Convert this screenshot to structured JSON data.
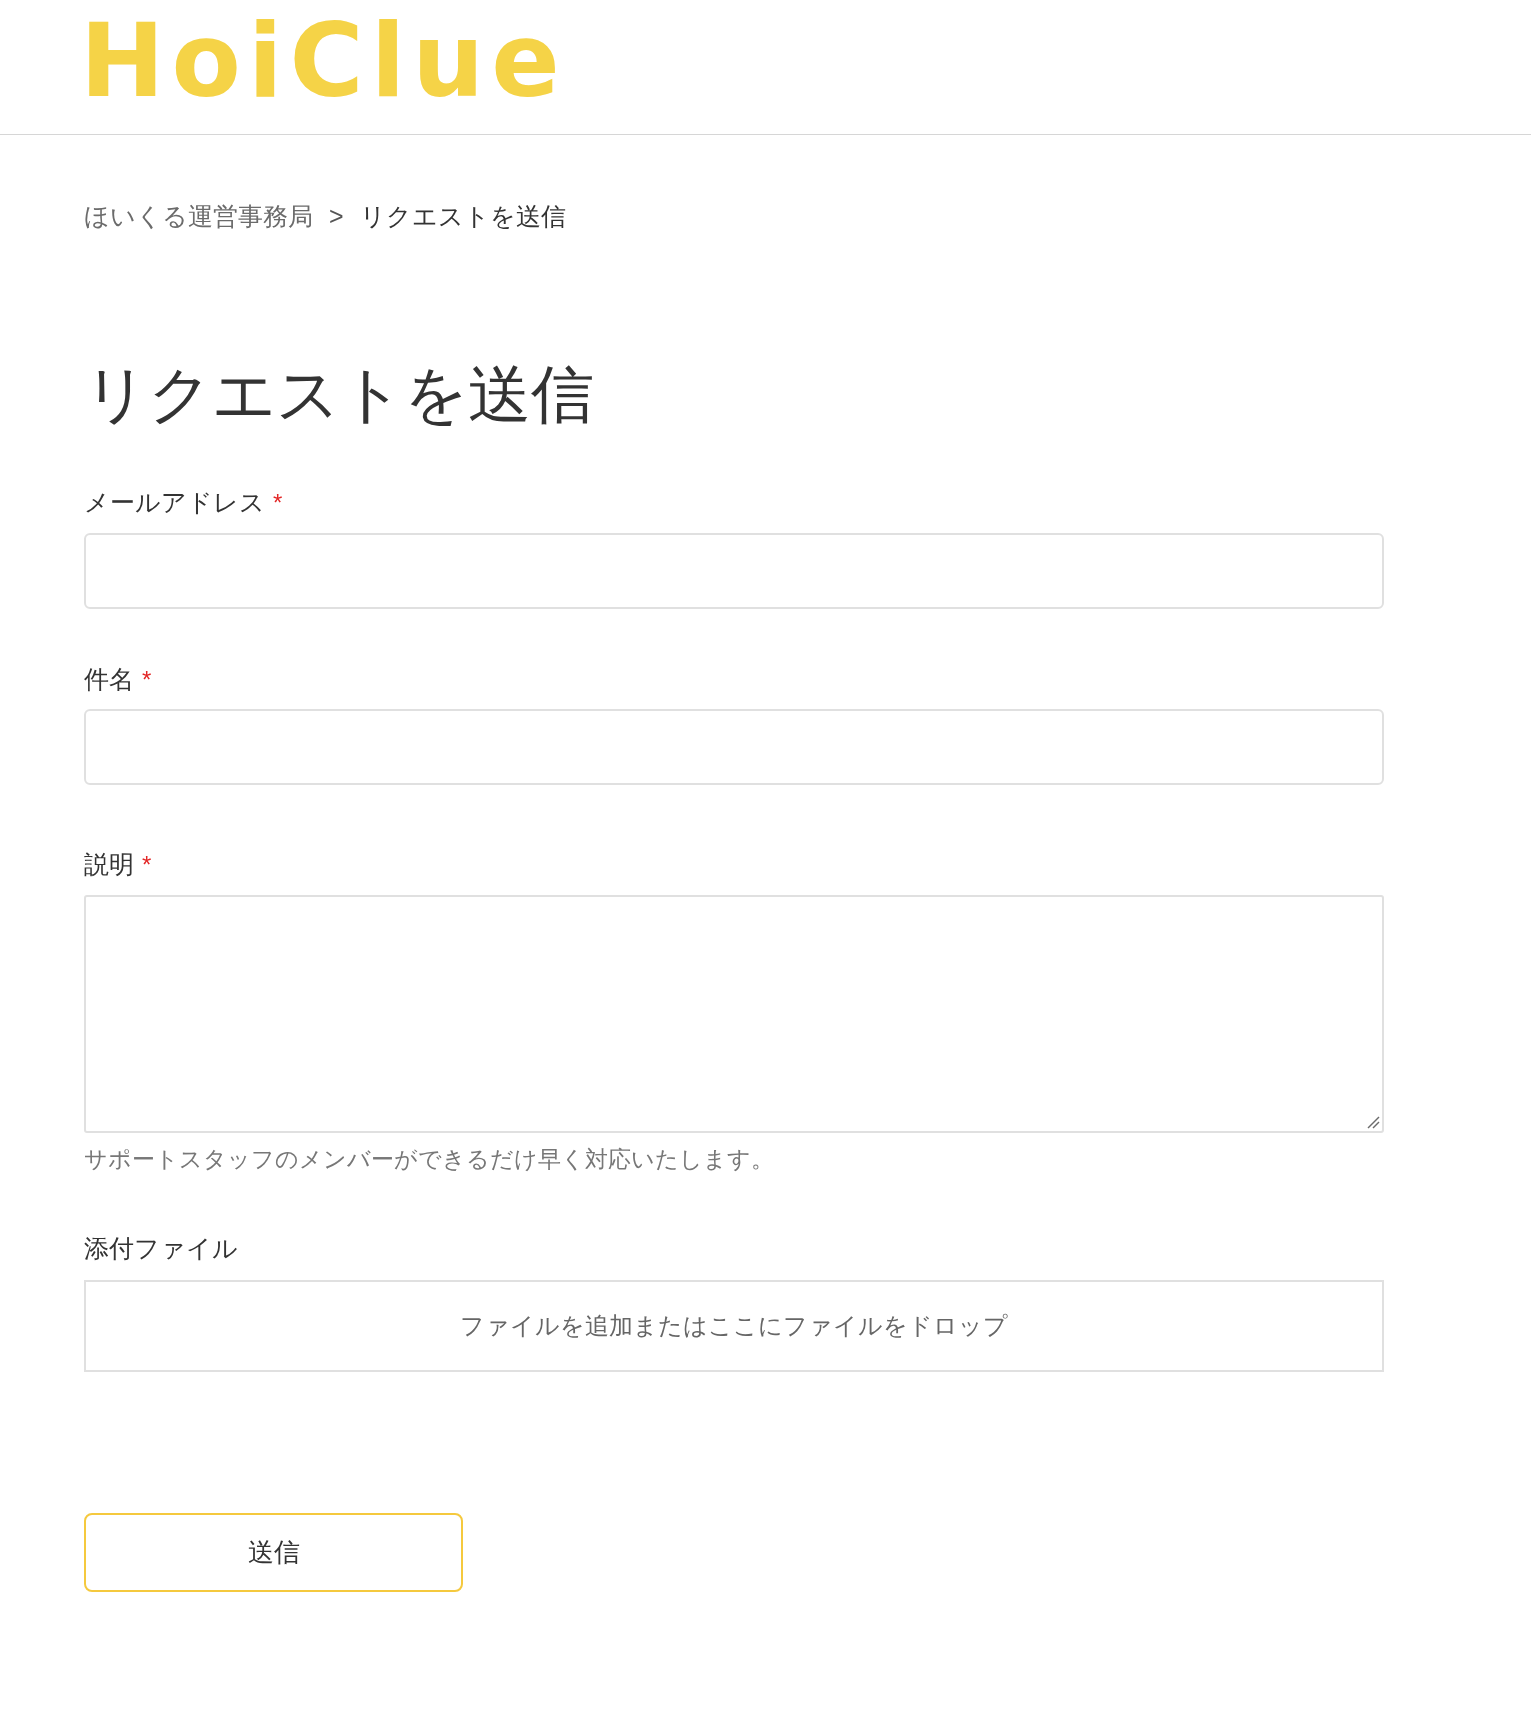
{
  "header": {
    "logo": "HoiClue"
  },
  "breadcrumb": {
    "separator": ">",
    "items": [
      {
        "label": "ほいくる運営事務局",
        "current": false
      },
      {
        "label": "リクエストを送信",
        "current": true
      }
    ]
  },
  "page_title": "リクエストを送信",
  "form": {
    "fields": [
      {
        "kind": "text",
        "label": "メールアドレス",
        "required_mark": "*"
      },
      {
        "kind": "text",
        "label": "件名",
        "required_mark": "*"
      },
      {
        "kind": "textarea",
        "label": "説明",
        "required_mark": "*",
        "hint": "サポートスタッフのメンバーができるだけ早く対応いたします。"
      },
      {
        "kind": "dropzone",
        "label": "添付ファイル",
        "prompt": "ファイルを追加またはここにファイルをドロップ"
      }
    ],
    "submit": "送信"
  }
}
